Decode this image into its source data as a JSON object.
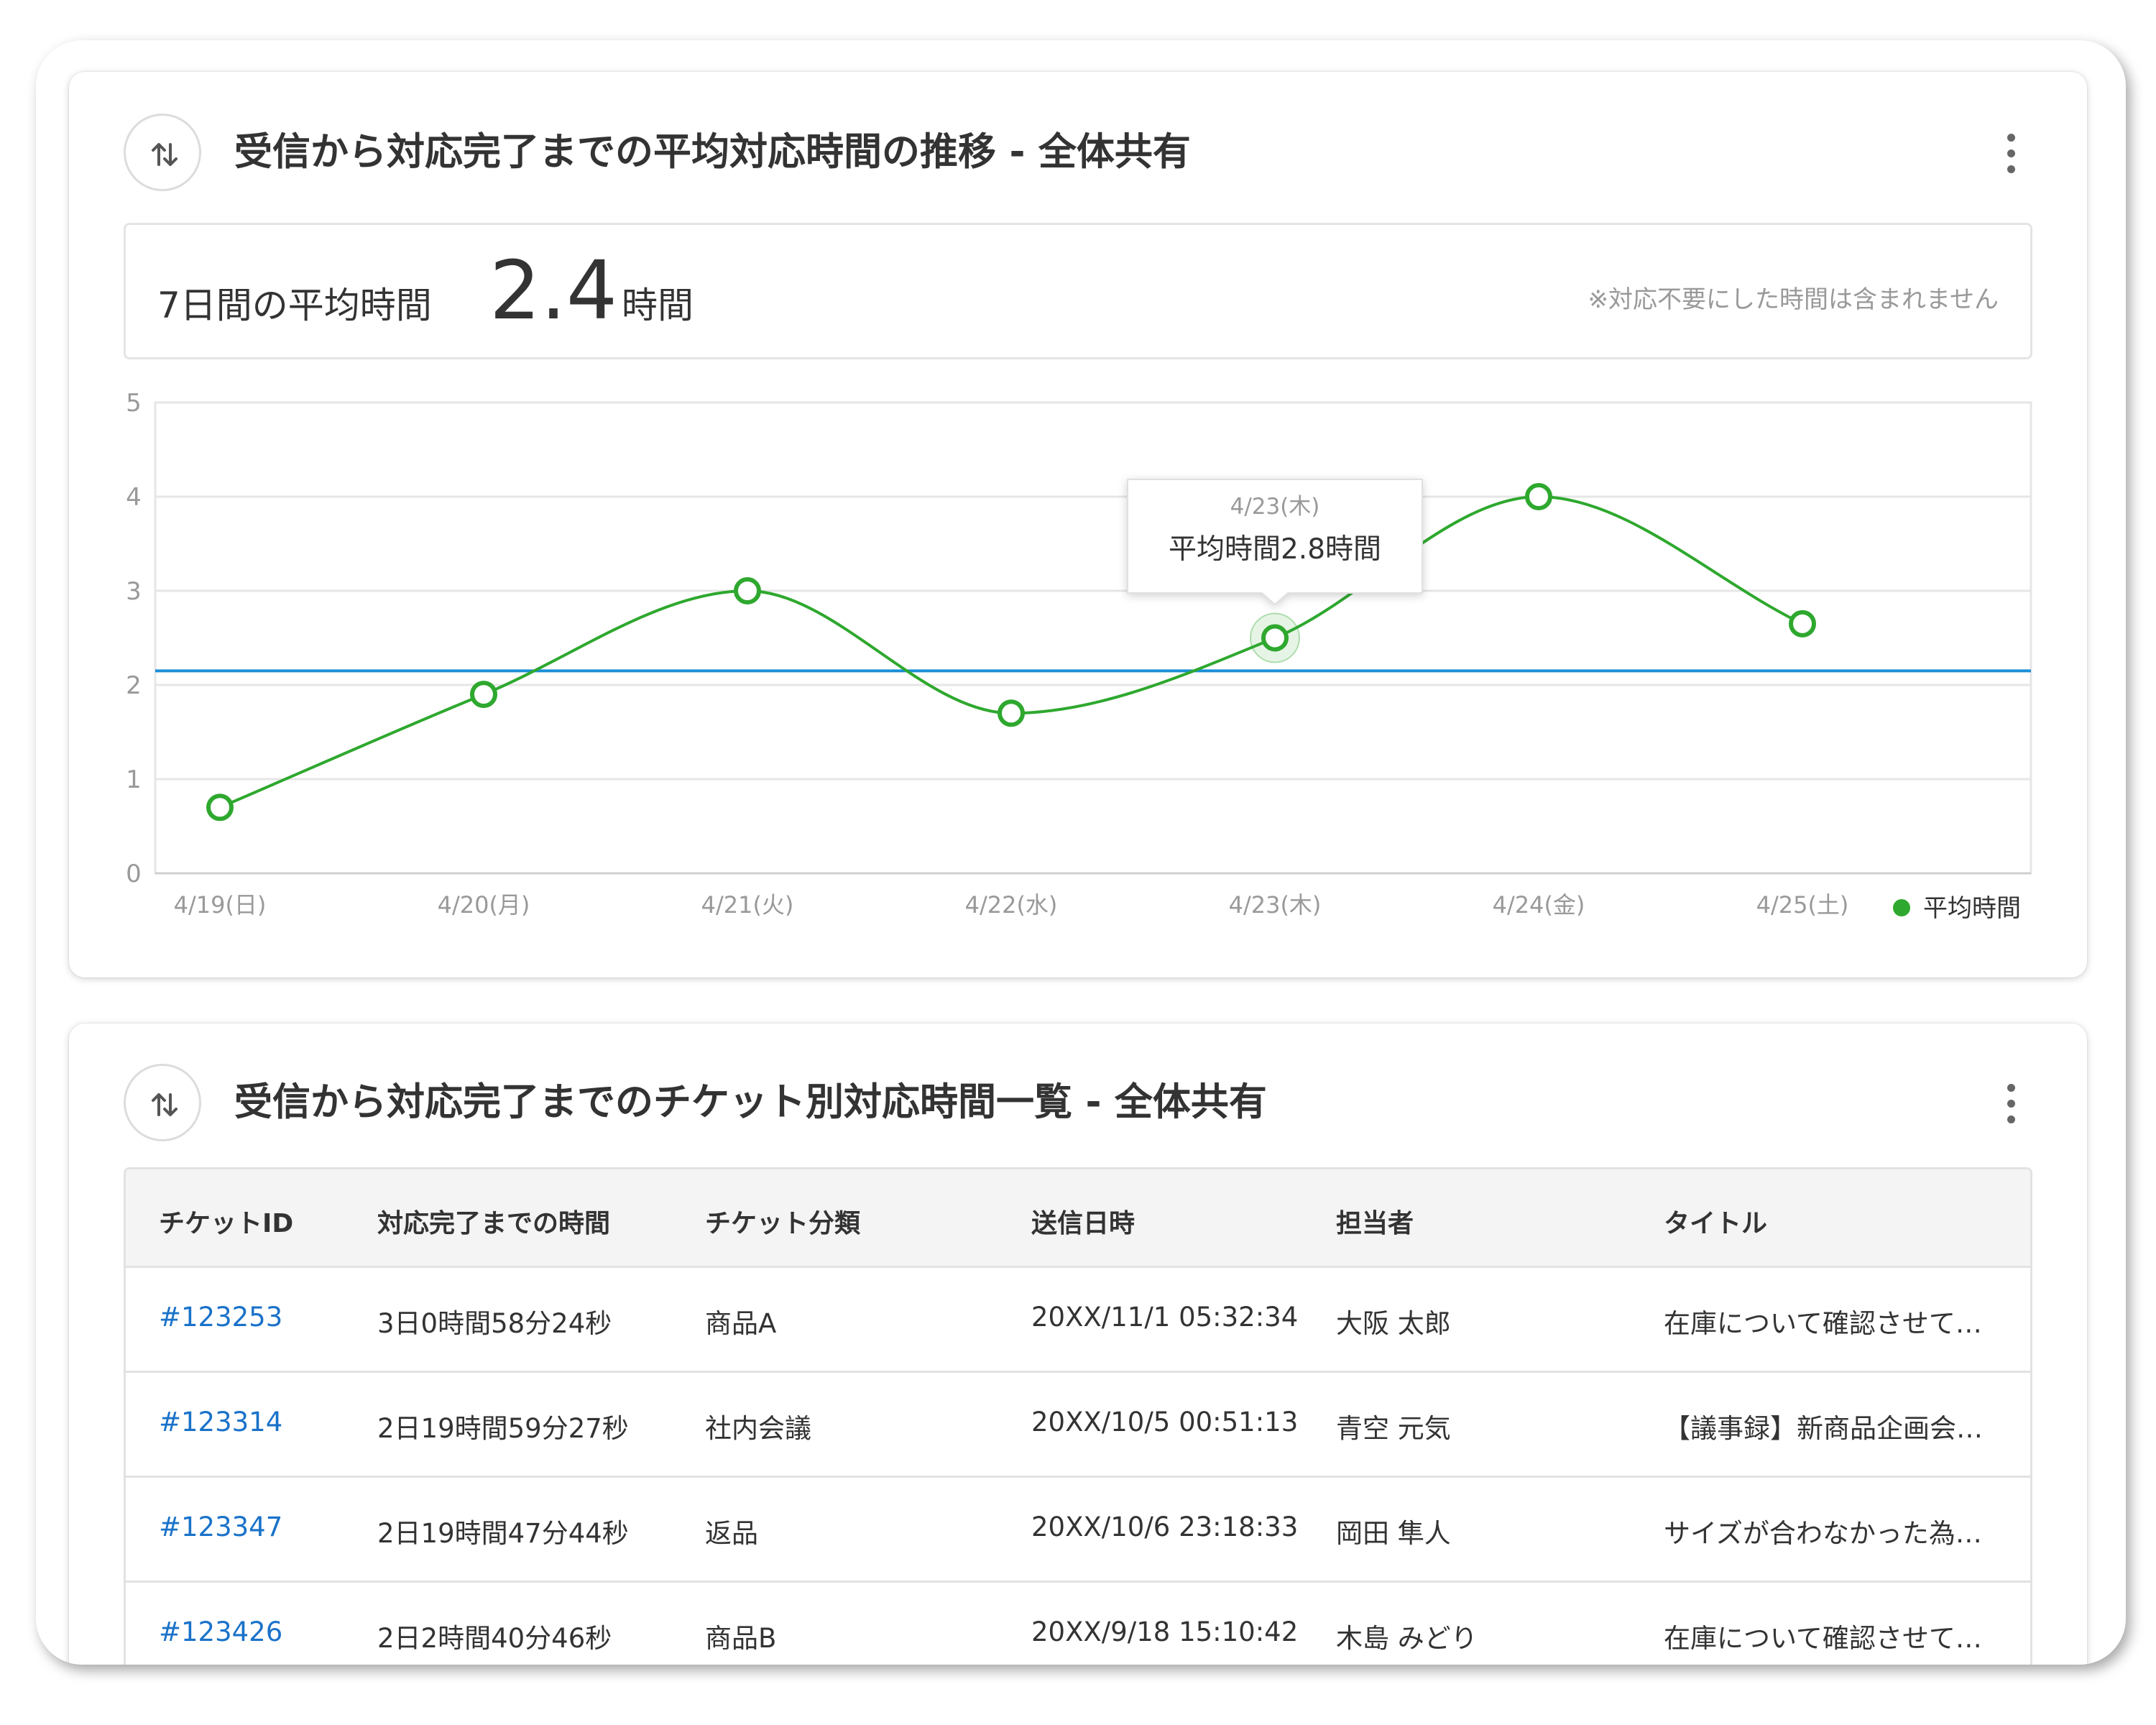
{
  "card1": {
    "title": "受信から対応完了までの平均対応時間の推移 - 全体共有",
    "summary": {
      "label": "7日間の平均時間",
      "value": "2.4",
      "unit": "時間",
      "note": "※対応不要にした時間は含まれません"
    },
    "tooltip": {
      "date": "4/23(木)",
      "text": "平均時間2.8時間"
    }
  },
  "chart_data": {
    "type": "line",
    "title": "",
    "xlabel": "",
    "ylabel": "",
    "categories": [
      "4/19(日)",
      "4/20(月)",
      "4/21(火)",
      "4/22(水)",
      "4/23(木)",
      "4/24(金)",
      "4/25(土)"
    ],
    "series": [
      {
        "name": "平均時間",
        "values": [
          0.7,
          1.9,
          3.0,
          1.7,
          2.5,
          4.0,
          2.65
        ],
        "color": "#2ea82e",
        "smooth": true
      }
    ],
    "reference_line": {
      "value": 2.15,
      "color": "#1a8fd6"
    },
    "ylim": [
      0,
      5
    ],
    "yticks": [
      "0",
      "1",
      "2",
      "3",
      "4",
      "5"
    ],
    "grid": true,
    "legend": "bottom-right",
    "highlighted_index": 4
  },
  "card2": {
    "title": "受信から対応完了までのチケット別対応時間一覧 - 全体共有",
    "columns": [
      "チケットID",
      "対応完了までの時間",
      "チケット分類",
      "送信日時",
      "担当者",
      "タイトル"
    ],
    "rows": [
      {
        "id": "#123253",
        "time": "3日0時間58分24秒",
        "category": "商品A",
        "sent": "20XX/11/1 05:32:34",
        "assignee": "大阪 太郎",
        "title": "在庫について確認させて…"
      },
      {
        "id": "#123314",
        "time": "2日19時間59分27秒",
        "category": "社内会議",
        "sent": "20XX/10/5 00:51:13",
        "assignee": "青空 元気",
        "title": "【議事録】新商品企画会議…"
      },
      {
        "id": "#123347",
        "time": "2日19時間47分44秒",
        "category": "返品",
        "sent": "20XX/10/6 23:18:33",
        "assignee": "岡田 隼人",
        "title": "サイズが合わなかった為…"
      },
      {
        "id": "#123426",
        "time": "2日2時間40分46秒",
        "category": "商品B",
        "sent": "20XX/9/18 15:10:42",
        "assignee": "木島 みどり",
        "title": "在庫について確認させて…"
      }
    ]
  }
}
